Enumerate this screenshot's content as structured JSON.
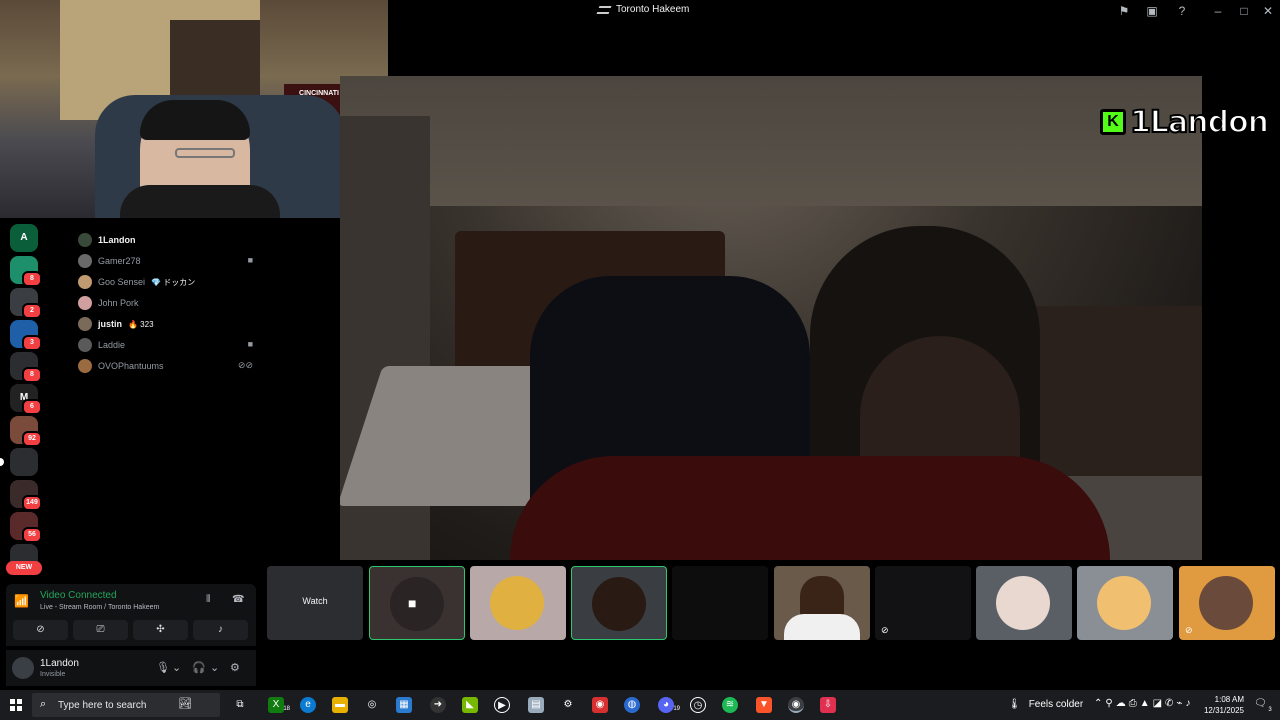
{
  "window": {
    "title": "Toronto Hakeem"
  },
  "overlay": {
    "webcam_banner_text": "CINCINNATI",
    "brand_text": "1Landon",
    "brand_badge": "K"
  },
  "servers": [
    {
      "label": "A",
      "color": "#0b5e3a",
      "badge": ""
    },
    {
      "label": "",
      "color": "#1d8f6a",
      "badge": "8"
    },
    {
      "label": "",
      "color": "#3a3d42",
      "badge": "2"
    },
    {
      "label": "",
      "color": "#1f5fa8",
      "badge": "3"
    },
    {
      "label": "",
      "color": "#2b2d31",
      "badge": "8"
    },
    {
      "label": "M",
      "color": "#222",
      "badge": "6"
    },
    {
      "label": "",
      "color": "#7a4a3a",
      "badge": "92"
    },
    {
      "label": "",
      "color": "#2b2d31",
      "badge": ""
    },
    {
      "label": "",
      "color": "#3a2a2a",
      "badge": "149"
    },
    {
      "label": "",
      "color": "#5a2a2a",
      "badge": "56"
    },
    {
      "label": "",
      "color": "#2b2d31",
      "badge": ""
    }
  ],
  "new_pill": "NEW",
  "members": [
    {
      "name": "1Landon",
      "active": true,
      "tag": "",
      "status_icon": ""
    },
    {
      "name": "Gamer278",
      "active": false,
      "tag": "",
      "status_icon": "camera-icon"
    },
    {
      "name": "Goo Sensei",
      "active": false,
      "tag": "💎 ドッカン",
      "status_icon": ""
    },
    {
      "name": "John Pork",
      "active": false,
      "tag": "",
      "status_icon": ""
    },
    {
      "name": "justin",
      "active": true,
      "tag": "🔥 323",
      "status_icon": ""
    },
    {
      "name": "Laddie",
      "active": false,
      "tag": "",
      "status_icon": "camera-icon"
    },
    {
      "name": "OVOPhantuums",
      "active": false,
      "tag": "",
      "status_icon": "muted-deafened-icon"
    }
  ],
  "voice": {
    "status": "Video Connected",
    "location": "Live - Stream Room / Toronto Hakeem"
  },
  "user": {
    "name": "1Landon",
    "status": "Invisible"
  },
  "tiles": {
    "watch_label": "Watch"
  },
  "taskbar": {
    "search_placeholder": "Type here to search",
    "xbox_count": "18",
    "discord_count": "19",
    "weather_text": "Feels colder",
    "time": "1:08 AM",
    "date": "12/31/2025",
    "notification_count": "3"
  },
  "colors": {
    "accent_green": "#23a55a",
    "tile_active_border": "#2dc770",
    "badge_red": "#f23f42",
    "kick_green": "#53fc18"
  }
}
